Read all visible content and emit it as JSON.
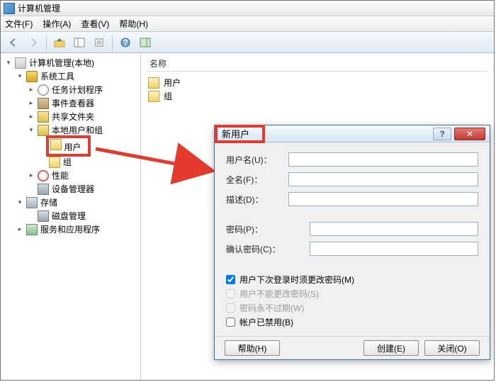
{
  "window": {
    "title": "计算机管理"
  },
  "menubar": {
    "file": "文件(F)",
    "action": "操作(A)",
    "view": "查看(V)",
    "help": "帮助(H)"
  },
  "tree": {
    "root": "计算机管理(本地)",
    "system_tools": "系统工具",
    "task_scheduler": "任务计划程序",
    "event_viewer": "事件查看器",
    "shared_folders": "共享文件夹",
    "local_users_groups": "本地用户和组",
    "users": "用户",
    "groups": "组",
    "performance": "性能",
    "device_manager": "设备管理器",
    "storage": "存储",
    "disk_management": "磁盘管理",
    "services_apps": "服务和应用程序"
  },
  "list": {
    "header": "名称",
    "items": [
      "用户",
      "组"
    ]
  },
  "dialog": {
    "title": "新用户",
    "username_label": "用户名(U)：",
    "fullname_label": "全名(F)：",
    "description_label": "描述(D)：",
    "password_label": "密码(P)：",
    "confirm_label": "确认密码(C)：",
    "chk_must_change": "用户下次登录时须更改密码(M)",
    "chk_cannot_change": "用户不能更改密码(S)",
    "chk_never_expire": "密码永不过期(W)",
    "chk_disabled": "帐户已禁用(B)",
    "btn_help": "帮助(H)",
    "btn_create": "创建(E)",
    "btn_close": "关闭(O)",
    "help_symbol": "?",
    "close_symbol": "✕"
  }
}
